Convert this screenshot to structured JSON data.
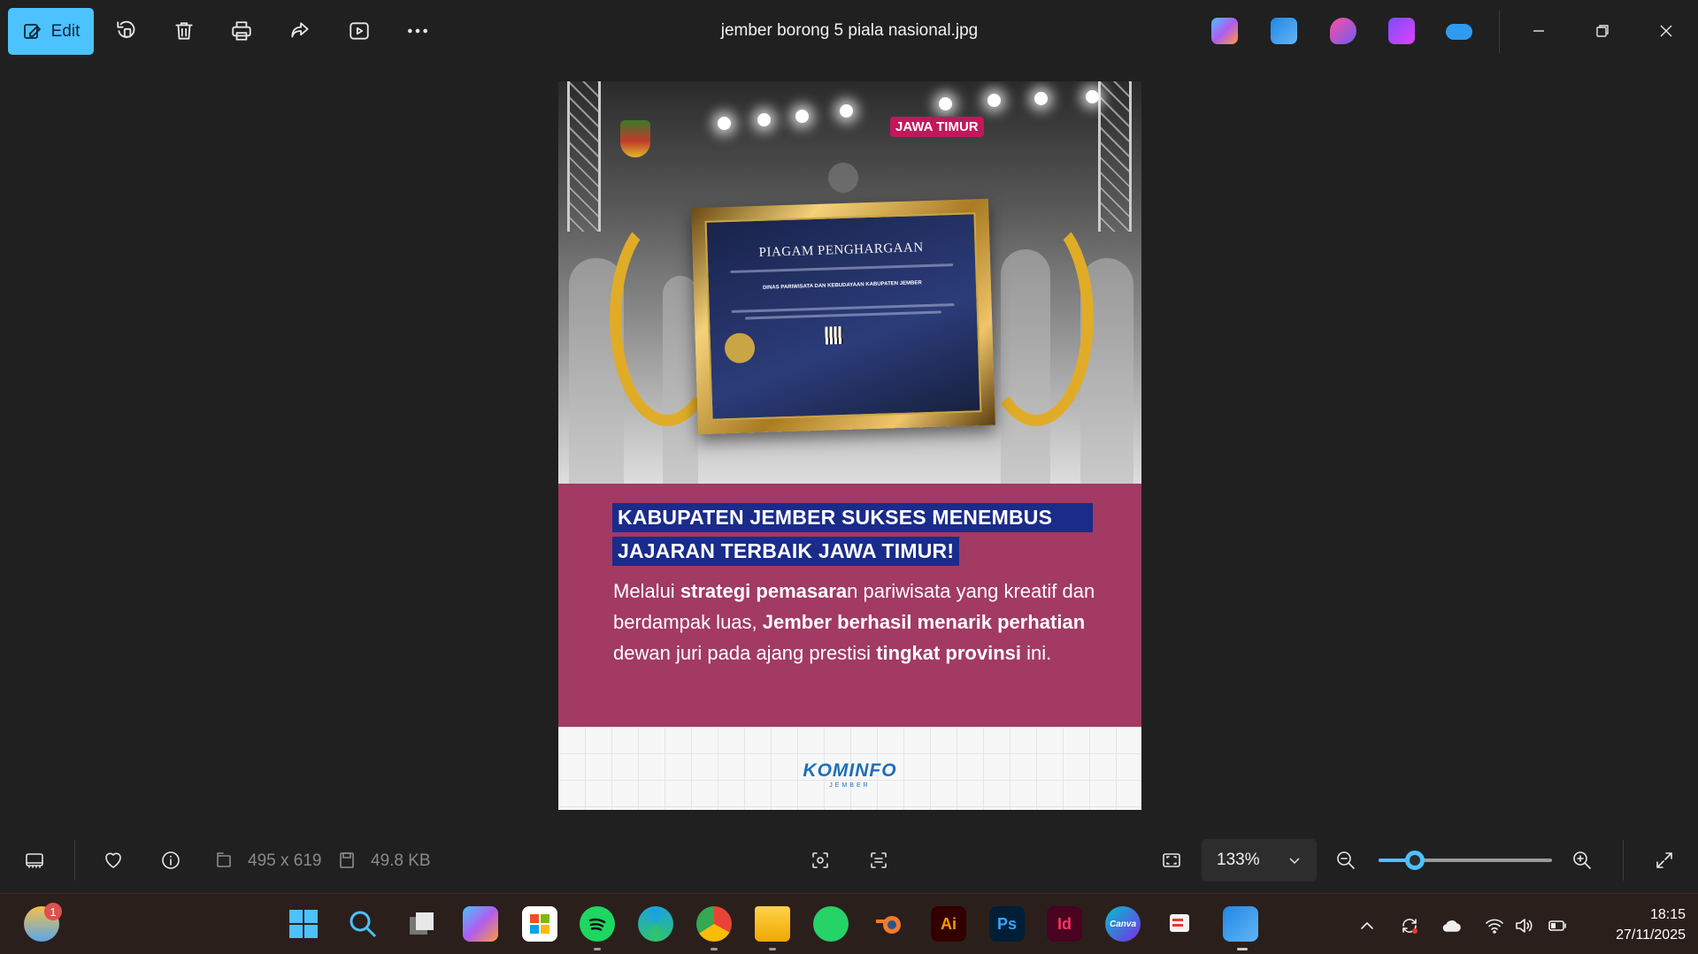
{
  "toolbar": {
    "edit_label": "Edit",
    "file_title": "jember borong 5 piala nasional.jpg",
    "icons": [
      "edit-icon",
      "rotate-icon",
      "delete-icon",
      "print-icon",
      "share-icon",
      "slideshow-icon",
      "more-icon"
    ],
    "accent_color": "#4cc2ff"
  },
  "header_apps": [
    "copilot-icon",
    "photos-icon",
    "designer-icon",
    "clipchamp-icon",
    "onedrive-icon"
  ],
  "image": {
    "logo_badge": "JAWA TIMUR",
    "certificate_title": "PIAGAM PENGHARGAAN",
    "certificate_body": "DINAS PARIWISATA DAN KEBUDAYAAN KABUPATEN JEMBER",
    "headline_1": "KABUPATEN JEMBER SUKSES MENEMBUS",
    "headline_2": "JAJARAN TERBAIK JAWA TIMUR!",
    "para_1": "Melalui ",
    "para_2": "strategi pemasara",
    "para_3": "n pariwisata yang kreatif dan berdampak luas, ",
    "para_4": "Jember berhasil menarik perhatian",
    "para_5": " dewan juri pada ajang prestisi ",
    "para_6": "tingkat provinsi",
    "para_7": " ini.",
    "footer_brand": "KOMINFO",
    "footer_sub": "JEMBER",
    "banner_color": "#a23a63",
    "headline_bg": "#1a2b8a"
  },
  "statusbar": {
    "dimensions": "495 x 619",
    "file_size": "49.8 KB",
    "zoom": "133%",
    "zoom_slider_fraction": 0.21
  },
  "taskbar": {
    "weather_badge": "1",
    "apps": [
      "weather",
      "start",
      "search",
      "task-view",
      "copilot",
      "store",
      "spotify",
      "edge",
      "chrome",
      "file-explorer",
      "whatsapp",
      "blender",
      "illustrator",
      "photoshop",
      "indesign",
      "canva",
      "snipping-tool",
      "photos"
    ],
    "ai_label": "Ai",
    "ps_label": "Ps",
    "id_label": "Id",
    "canva_label": "Canva",
    "time": "18:15",
    "date": "27/11/2025"
  }
}
